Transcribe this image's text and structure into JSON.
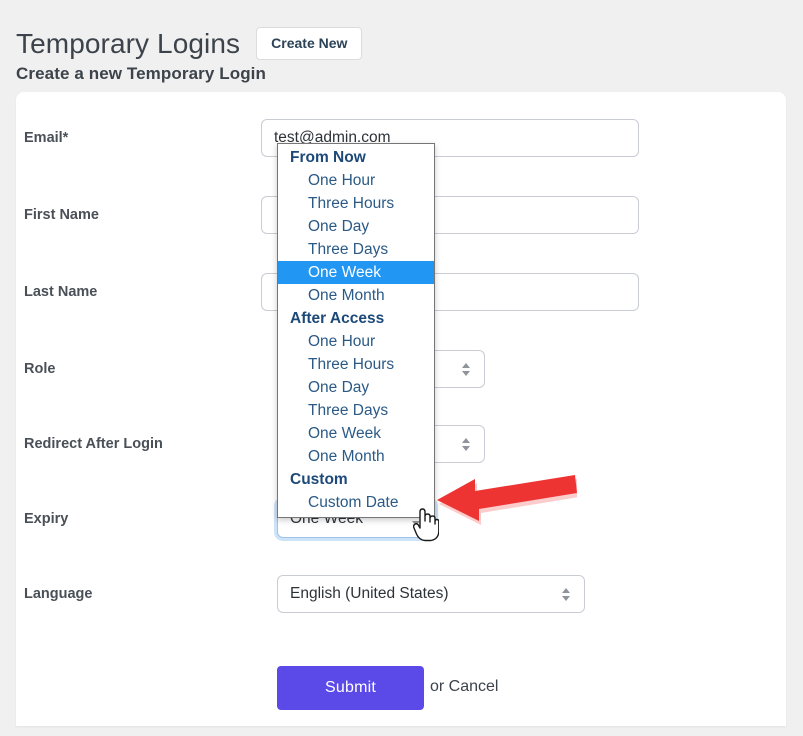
{
  "header": {
    "title": "Temporary Logins",
    "create_new_label": "Create New",
    "section_title": "Create a new Temporary Login"
  },
  "form": {
    "fields": [
      {
        "label": "Email*",
        "type": "text",
        "value": "test@admin.com",
        "placeholder": ""
      },
      {
        "label": "First Name",
        "type": "text",
        "value": "",
        "placeholder": ""
      },
      {
        "label": "Last Name",
        "type": "text",
        "value": "",
        "placeholder": ""
      },
      {
        "label": "Role",
        "type": "select",
        "value": ""
      },
      {
        "label": "Redirect After Login",
        "type": "select",
        "value": ""
      },
      {
        "label": "Expiry",
        "type": "select",
        "value": "One Week"
      },
      {
        "label": "Language",
        "type": "select",
        "value": "English (United States)"
      }
    ],
    "submit_label": "Submit",
    "or_text": "or ",
    "cancel_label": "Cancel"
  },
  "expiry_dropdown": {
    "open": true,
    "selected": "One Week",
    "groups": [
      {
        "label": "From Now",
        "options": [
          "One Hour",
          "Three Hours",
          "One Day",
          "Three Days",
          "One Week",
          "One Month"
        ]
      },
      {
        "label": "After Access",
        "options": [
          "One Hour",
          "Three Hours",
          "One Day",
          "Three Days",
          "One Week",
          "One Month"
        ]
      },
      {
        "label": "Custom",
        "options": [
          "Custom Date"
        ]
      }
    ]
  },
  "annotation": {
    "arrow_color": "#ee3333",
    "points_to": "expiry-select"
  },
  "colors": {
    "page_background": "#f0f0f1",
    "card_background": "#ffffff",
    "submit_button": "#5b4ae8",
    "dropdown_highlight": "#2196f3",
    "dropdown_group_text": "#1c4977",
    "dropdown_item_text": "#2b5a86",
    "focus_ring": "#cfe3f8",
    "label_text": "#4a5057"
  }
}
